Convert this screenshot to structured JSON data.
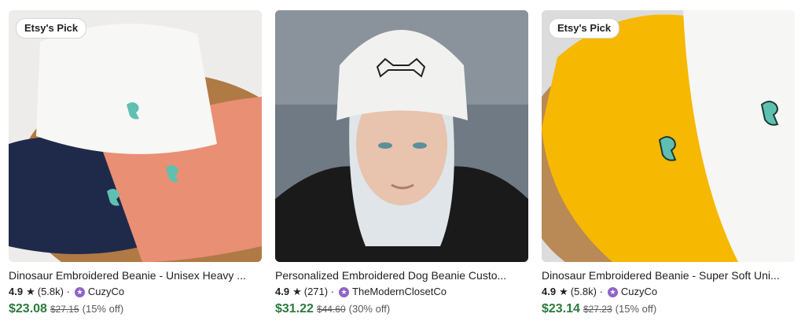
{
  "listings": [
    {
      "badge": "Etsy's Pick",
      "title": "Dinosaur Embroidered Beanie - Unisex Heavy ...",
      "rating": "4.9",
      "reviews": "(5.8k) ·",
      "shop": "CuzyCo",
      "price": "$23.08",
      "original_price": "$27.15",
      "discount": "(15% off)",
      "image_icon": "beanie-stack-image"
    },
    {
      "badge": "",
      "title": "Personalized Embroidered Dog Beanie Custo...",
      "rating": "4.9",
      "reviews": "(271) ·",
      "shop": "TheModernClosetCo",
      "price": "$31.22",
      "original_price": "$44.60",
      "discount": "(30% off)",
      "image_icon": "model-wearing-beanie-image"
    },
    {
      "badge": "Etsy's Pick",
      "title": "Dinosaur Embroidered Beanie - Super Soft Uni...",
      "rating": "4.9",
      "reviews": "(5.8k) ·",
      "shop": "CuzyCo",
      "price": "$23.14",
      "original_price": "$27.23",
      "discount": "(15% off)",
      "image_icon": "yellow-white-beanie-image"
    }
  ],
  "colors": {
    "price": "#2b7a3c",
    "star_seller": "#8f64c9"
  }
}
